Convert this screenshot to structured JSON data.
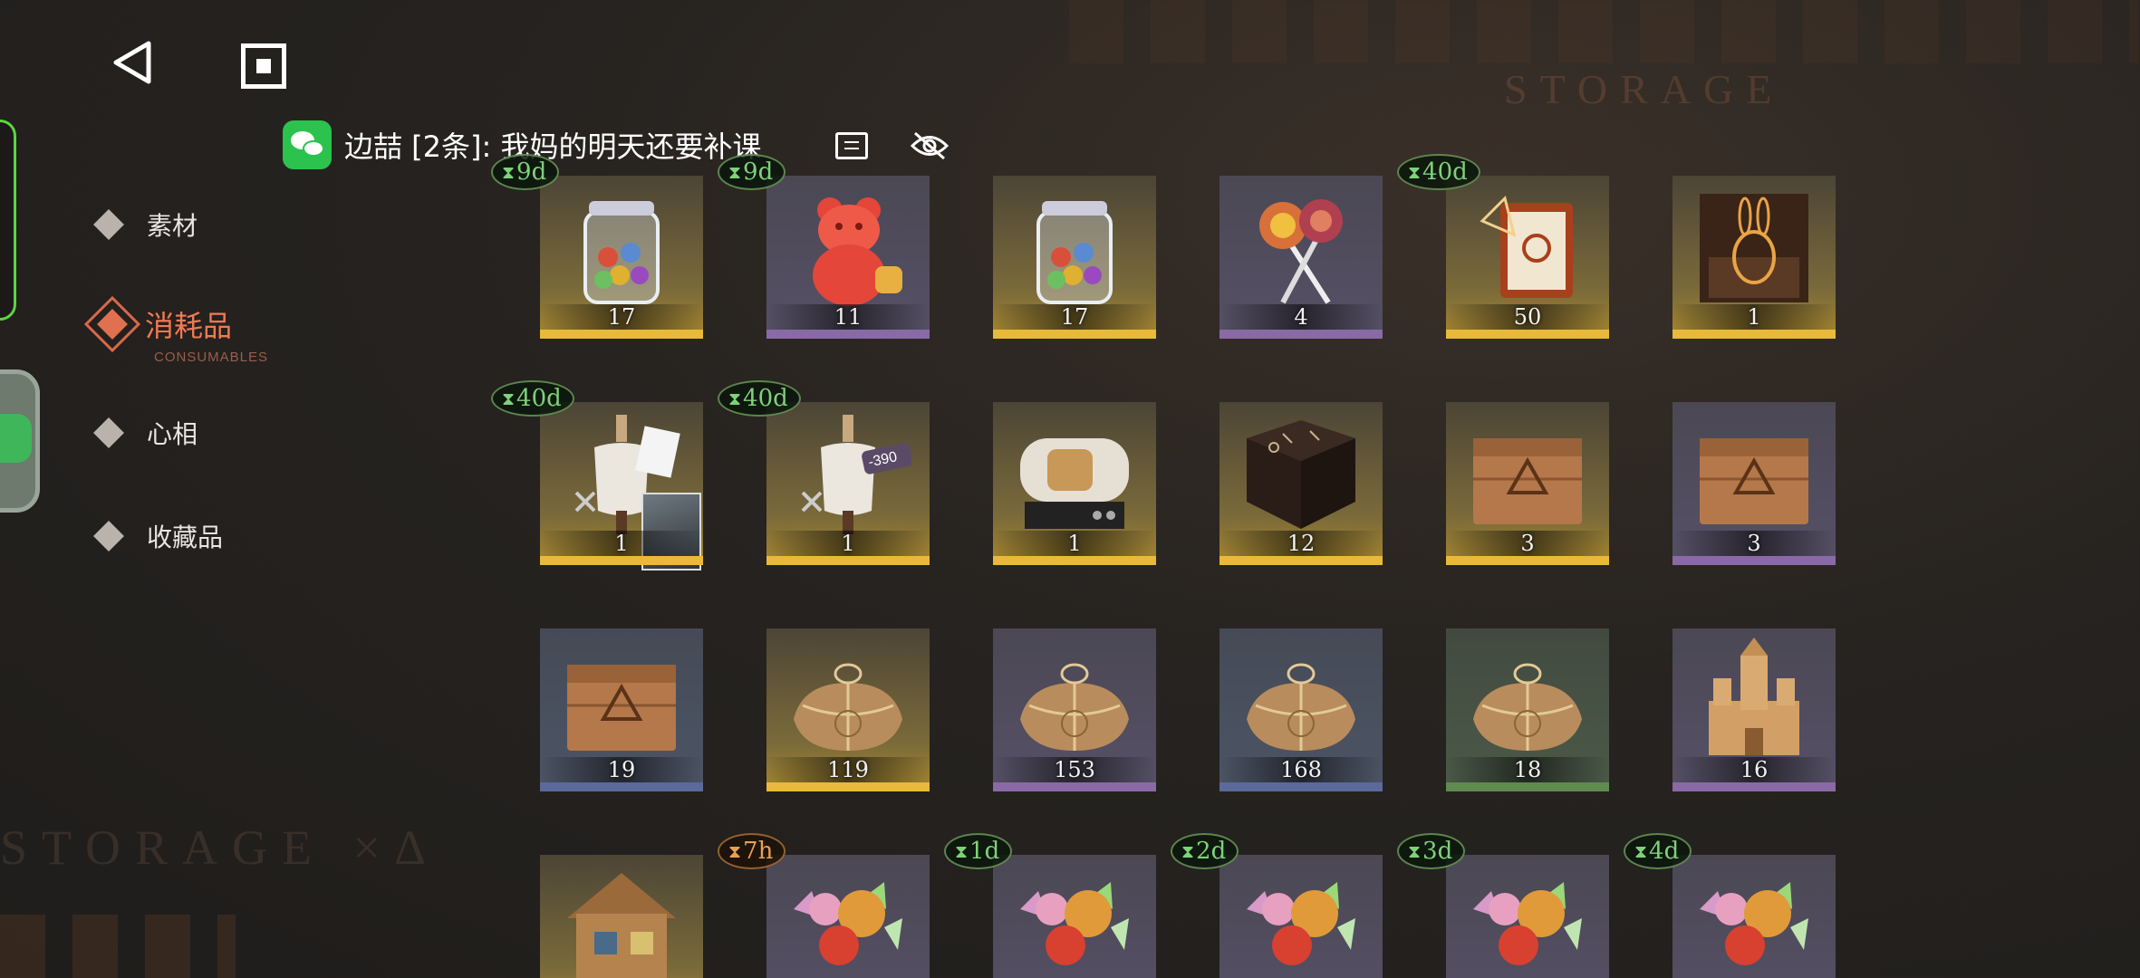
{
  "notification": {
    "app_icon": "wechat-icon",
    "text": "边喆 [2条]: 我妈的明天还要补课"
  },
  "background": {
    "storage_text": "STORAGE",
    "storage_text_2": "STORAGE ×∆"
  },
  "sidebar": {
    "items": [
      {
        "label": "素材",
        "active": false
      },
      {
        "label": "消耗品",
        "sub": "CONSUMABLES",
        "active": true
      },
      {
        "label": "心相",
        "active": false
      },
      {
        "label": "收藏品",
        "active": false
      }
    ]
  },
  "items": [
    {
      "name": "candy-jar",
      "count": "17",
      "timer": "9d",
      "rarity": "gold"
    },
    {
      "name": "gummy-bear",
      "count": "11",
      "timer": "9d",
      "rarity": "purple"
    },
    {
      "name": "candy-jar",
      "count": "17",
      "timer": "",
      "rarity": "gold"
    },
    {
      "name": "lollipops",
      "count": "4",
      "timer": "",
      "rarity": "purple"
    },
    {
      "name": "tarot-book",
      "count": "50",
      "timer": "40d",
      "rarity": "gold"
    },
    {
      "name": "rabbit-figure-box",
      "count": "1",
      "timer": "",
      "rarity": "gold"
    },
    {
      "name": "tailor-mannequin",
      "count": "1",
      "timer": "40d",
      "rarity": "gold"
    },
    {
      "name": "tailor-mannequin-discount",
      "count": "1",
      "timer": "40d",
      "rarity": "gold",
      "tag": "-390"
    },
    {
      "name": "incubator-machine",
      "count": "1",
      "timer": "",
      "rarity": "gold"
    },
    {
      "name": "rune-table",
      "count": "12",
      "timer": "",
      "rarity": "gold"
    },
    {
      "name": "wooden-crate",
      "count": "3",
      "timer": "",
      "rarity": "gold"
    },
    {
      "name": "wooden-crate",
      "count": "3",
      "timer": "",
      "rarity": "purple"
    },
    {
      "name": "wooden-crate",
      "count": "19",
      "timer": "",
      "rarity": "blue"
    },
    {
      "name": "paper-parcel",
      "count": "119",
      "timer": "",
      "rarity": "gold"
    },
    {
      "name": "paper-parcel",
      "count": "153",
      "timer": "",
      "rarity": "purple"
    },
    {
      "name": "paper-parcel",
      "count": "168",
      "timer": "",
      "rarity": "blue"
    },
    {
      "name": "paper-parcel",
      "count": "18",
      "timer": "",
      "rarity": "green"
    },
    {
      "name": "sand-castle",
      "count": "16",
      "timer": "",
      "rarity": "purple"
    },
    {
      "name": "wooden-house",
      "count": "",
      "timer": "",
      "rarity": "gold"
    },
    {
      "name": "wrapped-candies",
      "count": "",
      "timer": "7h",
      "timer_color": "orange",
      "rarity": "purple"
    },
    {
      "name": "wrapped-candies",
      "count": "",
      "timer": "1d",
      "rarity": "purple"
    },
    {
      "name": "wrapped-candies",
      "count": "",
      "timer": "2d",
      "rarity": "purple"
    },
    {
      "name": "wrapped-candies",
      "count": "",
      "timer": "3d",
      "rarity": "purple"
    },
    {
      "name": "wrapped-candies",
      "count": "",
      "timer": "4d",
      "rarity": "purple"
    }
  ],
  "colors": {
    "accent": "#f07a55",
    "timer_green": "#7fd17a",
    "timer_orange": "#e7a253",
    "rarity_gold": "#e9b93a",
    "rarity_purple": "#8a6aa6",
    "rarity_blue": "#5a6a9a",
    "rarity_green": "#5f8b4f"
  }
}
